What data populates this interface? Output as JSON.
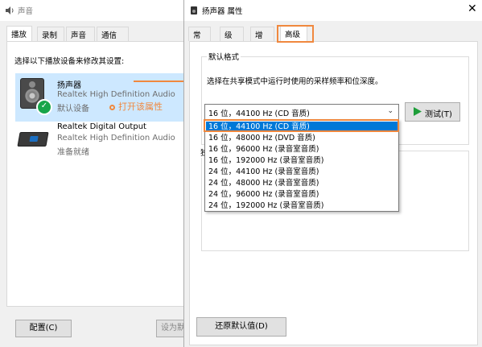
{
  "sound_window": {
    "title": "声音",
    "tabs": [
      "播放",
      "录制",
      "声音",
      "通信"
    ],
    "instruction": "选择以下播放设备来修改其设置:",
    "devices": [
      {
        "name": "扬声器",
        "driver": "Realtek High Definition Audio",
        "status": "默认设备"
      },
      {
        "name": "Realtek Digital Output",
        "driver": "Realtek High Definition Audio",
        "status": "准备就绪"
      }
    ],
    "configure_button": "配置(C)",
    "set_default_button": "设为默"
  },
  "annotation": {
    "label": "打开该属性",
    "color": "#f0883e"
  },
  "properties_window": {
    "title": "扬声器 属性",
    "tabs": [
      "常规",
      "级别",
      "增强",
      "高级"
    ],
    "active_tab": "高级",
    "default_format": {
      "caption": "默认格式",
      "description": "选择在共享模式中运行时使用的采样频率和位深度。",
      "selected_value": "16 位，44100 Hz (CD 音质)",
      "options": [
        "16 位，44100 Hz (CD 音质)",
        "16 位，48000 Hz (DVD 音质)",
        "16 位，96000 Hz (录音室音质)",
        "16 位，192000 Hz (录音室音质)",
        "24 位，44100 Hz (录音室音质)",
        "24 位，48000 Hz (录音室音质)",
        "24 位，96000 Hz (录音室音质)",
        "24 位，192000 Hz (录音室音质)"
      ],
      "test_button": "测试(T)"
    },
    "exclusive_caption_fragment": "独",
    "restore_button": "还原默认值(D)"
  },
  "colors": {
    "accent": "#0078d7",
    "selection_row": "#cde8ff",
    "highlight_orange": "#f0883e",
    "check_green": "#18a54a",
    "play_green": "#1e9e3a"
  }
}
